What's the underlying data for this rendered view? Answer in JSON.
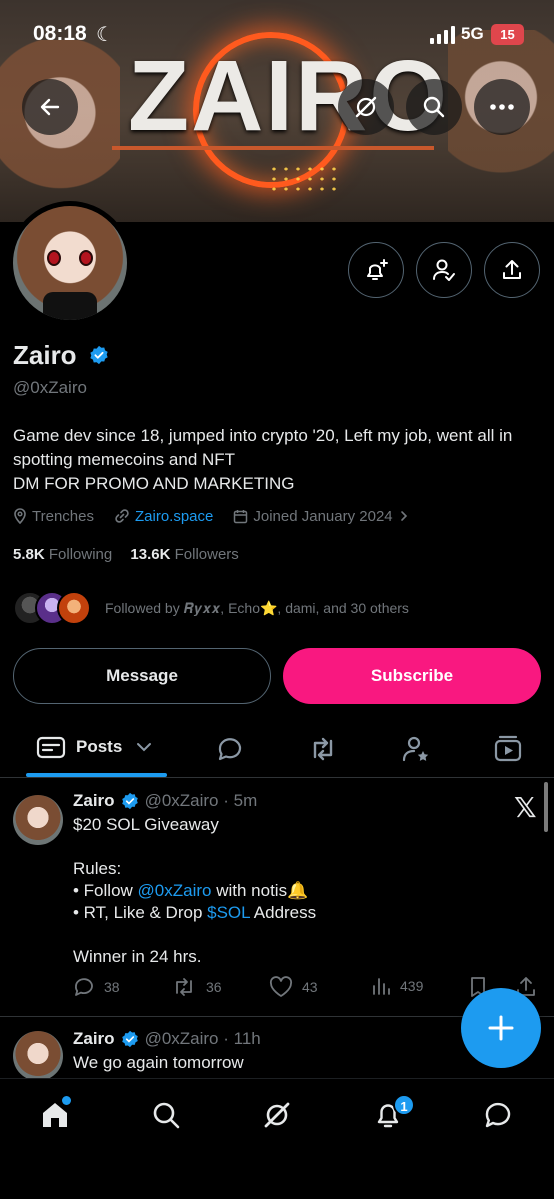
{
  "status_bar": {
    "time": "08:18",
    "network": "5G",
    "battery": "15"
  },
  "banner": {
    "wordmark": "ZAIRO"
  },
  "profile": {
    "name": "Zairo",
    "handle": "@0xZairo",
    "bio_lines": [
      "Game dev since 18, jumped into crypto '20, Left my job, went all in",
      "spotting memecoins and NFT",
      "DM FOR PROMO AND MARKETING"
    ],
    "location": "Trenches",
    "website": "Zairo.space",
    "joined": "Joined January 2024",
    "following_count": "5.8K",
    "following_label": "Following",
    "followers_count": "13.6K",
    "followers_label": "Followers",
    "followed_by_prefix": "Followed by ",
    "followed_by_names": "𝑹𝒚𝒙𝒙, Echo⭐, dami, and 30 others"
  },
  "buttons": {
    "message": "Message",
    "subscribe": "Subscribe"
  },
  "tabs": {
    "posts_label": "Posts"
  },
  "posts": [
    {
      "name": "Zairo",
      "handle": "@0xZairo",
      "time": "5m",
      "title_line": "$20 SOL  Giveaway",
      "rules_label": "Rules:",
      "rule1_prefix": "• Follow ",
      "rule1_mention": "@0xZairo",
      "rule1_suffix": " with notis🔔",
      "rule2_prefix": "• RT, Like & Drop ",
      "rule2_cashtag": "$SOL",
      "rule2_suffix": " Address",
      "winner_line": "Winner in 24 hrs.",
      "replies": "38",
      "reposts": "36",
      "likes": "43",
      "views": "439"
    },
    {
      "name": "Zairo",
      "handle": "@0xZairo",
      "time": "11h",
      "text": "We go again tomorrow"
    }
  ],
  "nav": {
    "notifications_badge": "1"
  },
  "colors": {
    "accent": "#1d9bf0",
    "subscribe": "#f91880",
    "muted": "#71767b",
    "battery": "#e0464c"
  }
}
